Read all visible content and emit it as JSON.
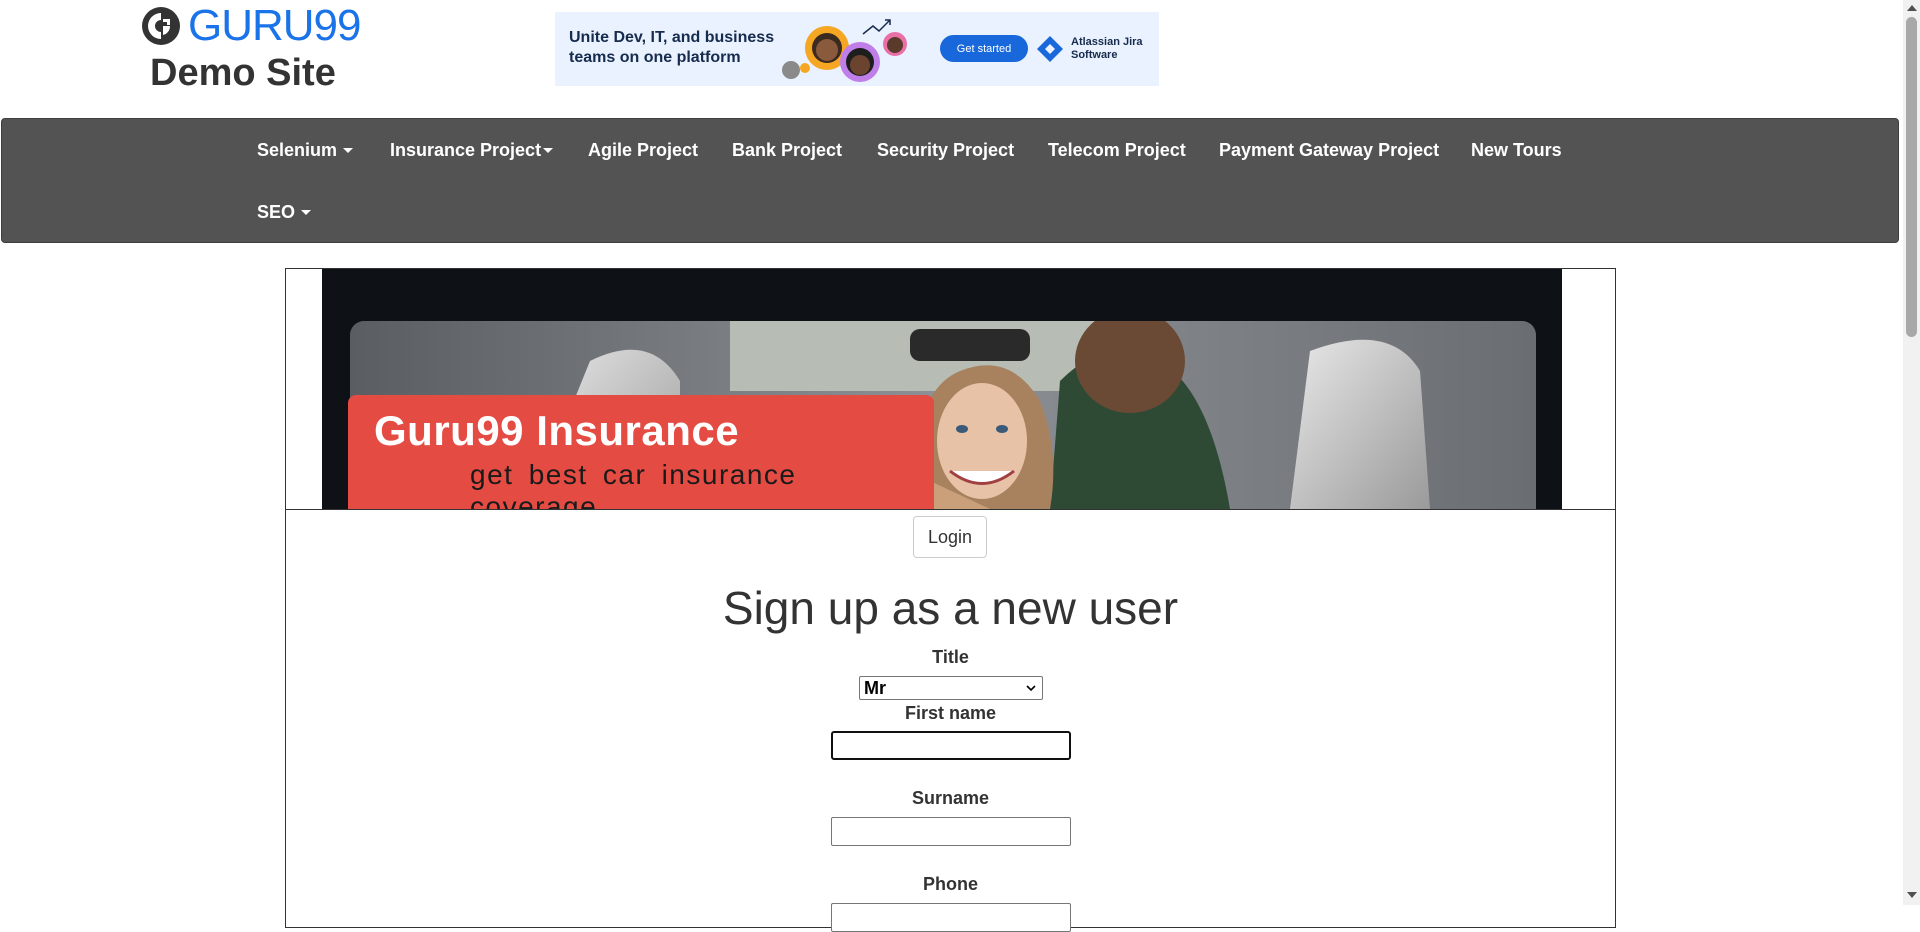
{
  "header": {
    "logo_text": "GURU99",
    "site_title": "Demo Site"
  },
  "ad": {
    "headline": "Unite Dev, IT, and business teams on one platform",
    "cta_label": "Get started",
    "brand_label": "Atlassian Jira Software",
    "colors": {
      "background": "#e9f2fe",
      "cta": "#1868db"
    }
  },
  "nav": {
    "items": [
      {
        "label": "Selenium",
        "has_dropdown": true
      },
      {
        "label": "Insurance Project",
        "has_dropdown": true
      },
      {
        "label": "Agile Project",
        "has_dropdown": false
      },
      {
        "label": "Bank Project",
        "has_dropdown": false
      },
      {
        "label": "Security Project",
        "has_dropdown": false
      },
      {
        "label": "Telecom Project",
        "has_dropdown": false
      },
      {
        "label": "Payment Gateway Project",
        "has_dropdown": false
      },
      {
        "label": "New Tours",
        "has_dropdown": false
      },
      {
        "label": "SEO",
        "has_dropdown": true
      }
    ],
    "colors": {
      "background": "#535353",
      "text": "#ffffff"
    }
  },
  "hero": {
    "title": "Guru99 Insurance",
    "subtitle": "get best car insurance coverage",
    "colors": {
      "banner": "#e44b43"
    }
  },
  "login": {
    "label": "Login"
  },
  "form": {
    "heading": "Sign up as a new user",
    "title_label": "Title",
    "title_value": "Mr",
    "first_name_label": "First name",
    "first_name_value": "",
    "surname_label": "Surname",
    "surname_value": "",
    "phone_label": "Phone",
    "phone_value": ""
  }
}
